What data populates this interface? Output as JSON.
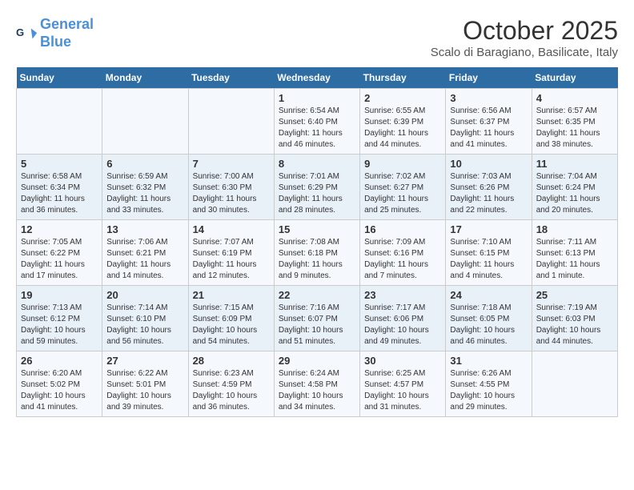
{
  "header": {
    "logo_line1": "General",
    "logo_line2": "Blue",
    "month": "October 2025",
    "location": "Scalo di Baragiano, Basilicate, Italy"
  },
  "days_of_week": [
    "Sunday",
    "Monday",
    "Tuesday",
    "Wednesday",
    "Thursday",
    "Friday",
    "Saturday"
  ],
  "weeks": [
    [
      {
        "day": "",
        "info": ""
      },
      {
        "day": "",
        "info": ""
      },
      {
        "day": "",
        "info": ""
      },
      {
        "day": "1",
        "info": "Sunrise: 6:54 AM\nSunset: 6:40 PM\nDaylight: 11 hours and 46 minutes."
      },
      {
        "day": "2",
        "info": "Sunrise: 6:55 AM\nSunset: 6:39 PM\nDaylight: 11 hours and 44 minutes."
      },
      {
        "day": "3",
        "info": "Sunrise: 6:56 AM\nSunset: 6:37 PM\nDaylight: 11 hours and 41 minutes."
      },
      {
        "day": "4",
        "info": "Sunrise: 6:57 AM\nSunset: 6:35 PM\nDaylight: 11 hours and 38 minutes."
      }
    ],
    [
      {
        "day": "5",
        "info": "Sunrise: 6:58 AM\nSunset: 6:34 PM\nDaylight: 11 hours and 36 minutes."
      },
      {
        "day": "6",
        "info": "Sunrise: 6:59 AM\nSunset: 6:32 PM\nDaylight: 11 hours and 33 minutes."
      },
      {
        "day": "7",
        "info": "Sunrise: 7:00 AM\nSunset: 6:30 PM\nDaylight: 11 hours and 30 minutes."
      },
      {
        "day": "8",
        "info": "Sunrise: 7:01 AM\nSunset: 6:29 PM\nDaylight: 11 hours and 28 minutes."
      },
      {
        "day": "9",
        "info": "Sunrise: 7:02 AM\nSunset: 6:27 PM\nDaylight: 11 hours and 25 minutes."
      },
      {
        "day": "10",
        "info": "Sunrise: 7:03 AM\nSunset: 6:26 PM\nDaylight: 11 hours and 22 minutes."
      },
      {
        "day": "11",
        "info": "Sunrise: 7:04 AM\nSunset: 6:24 PM\nDaylight: 11 hours and 20 minutes."
      }
    ],
    [
      {
        "day": "12",
        "info": "Sunrise: 7:05 AM\nSunset: 6:22 PM\nDaylight: 11 hours and 17 minutes."
      },
      {
        "day": "13",
        "info": "Sunrise: 7:06 AM\nSunset: 6:21 PM\nDaylight: 11 hours and 14 minutes."
      },
      {
        "day": "14",
        "info": "Sunrise: 7:07 AM\nSunset: 6:19 PM\nDaylight: 11 hours and 12 minutes."
      },
      {
        "day": "15",
        "info": "Sunrise: 7:08 AM\nSunset: 6:18 PM\nDaylight: 11 hours and 9 minutes."
      },
      {
        "day": "16",
        "info": "Sunrise: 7:09 AM\nSunset: 6:16 PM\nDaylight: 11 hours and 7 minutes."
      },
      {
        "day": "17",
        "info": "Sunrise: 7:10 AM\nSunset: 6:15 PM\nDaylight: 11 hours and 4 minutes."
      },
      {
        "day": "18",
        "info": "Sunrise: 7:11 AM\nSunset: 6:13 PM\nDaylight: 11 hours and 1 minute."
      }
    ],
    [
      {
        "day": "19",
        "info": "Sunrise: 7:13 AM\nSunset: 6:12 PM\nDaylight: 10 hours and 59 minutes."
      },
      {
        "day": "20",
        "info": "Sunrise: 7:14 AM\nSunset: 6:10 PM\nDaylight: 10 hours and 56 minutes."
      },
      {
        "day": "21",
        "info": "Sunrise: 7:15 AM\nSunset: 6:09 PM\nDaylight: 10 hours and 54 minutes."
      },
      {
        "day": "22",
        "info": "Sunrise: 7:16 AM\nSunset: 6:07 PM\nDaylight: 10 hours and 51 minutes."
      },
      {
        "day": "23",
        "info": "Sunrise: 7:17 AM\nSunset: 6:06 PM\nDaylight: 10 hours and 49 minutes."
      },
      {
        "day": "24",
        "info": "Sunrise: 7:18 AM\nSunset: 6:05 PM\nDaylight: 10 hours and 46 minutes."
      },
      {
        "day": "25",
        "info": "Sunrise: 7:19 AM\nSunset: 6:03 PM\nDaylight: 10 hours and 44 minutes."
      }
    ],
    [
      {
        "day": "26",
        "info": "Sunrise: 6:20 AM\nSunset: 5:02 PM\nDaylight: 10 hours and 41 minutes."
      },
      {
        "day": "27",
        "info": "Sunrise: 6:22 AM\nSunset: 5:01 PM\nDaylight: 10 hours and 39 minutes."
      },
      {
        "day": "28",
        "info": "Sunrise: 6:23 AM\nSunset: 4:59 PM\nDaylight: 10 hours and 36 minutes."
      },
      {
        "day": "29",
        "info": "Sunrise: 6:24 AM\nSunset: 4:58 PM\nDaylight: 10 hours and 34 minutes."
      },
      {
        "day": "30",
        "info": "Sunrise: 6:25 AM\nSunset: 4:57 PM\nDaylight: 10 hours and 31 minutes."
      },
      {
        "day": "31",
        "info": "Sunrise: 6:26 AM\nSunset: 4:55 PM\nDaylight: 10 hours and 29 minutes."
      },
      {
        "day": "",
        "info": ""
      }
    ]
  ]
}
